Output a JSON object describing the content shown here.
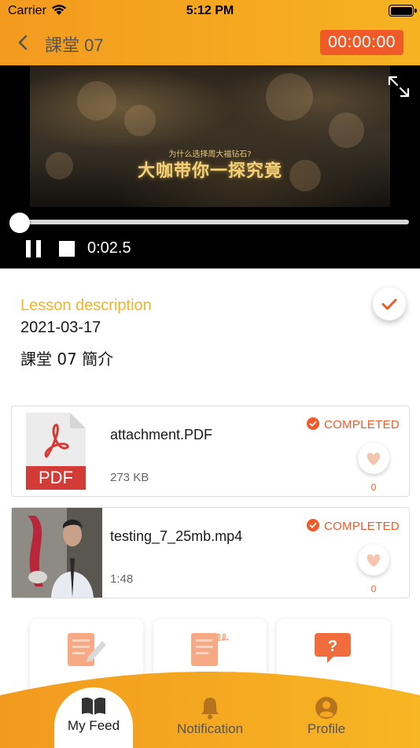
{
  "status_bar": {
    "carrier": "Carrier",
    "time": "5:12 PM"
  },
  "nav": {
    "title": "課堂 07",
    "timer": "00:00:00"
  },
  "player": {
    "caption_sub": "为什么选择周大福钻石?",
    "caption_main": "大咖带你一探究竟",
    "elapsed": "0:02.5",
    "progress_fraction": 0.0
  },
  "lesson": {
    "label": "Lesson description",
    "date": "2021-03-17",
    "description": "課堂 07 簡介"
  },
  "attachments": [
    {
      "title": "attachment.PDF",
      "meta": "273 KB",
      "status": "COMPLETED",
      "likes": "0",
      "thumb_label": "PDF"
    },
    {
      "title": "testing_7_25mb.mp4",
      "meta": "1:48",
      "status": "COMPLETED",
      "likes": "0"
    }
  ],
  "tabs": {
    "feed": "My Feed",
    "notification": "Notification",
    "profile": "Profile"
  },
  "colors": {
    "brand_orange": "#f5a623",
    "accent": "#f05a28",
    "label_gold": "#f5b327"
  }
}
